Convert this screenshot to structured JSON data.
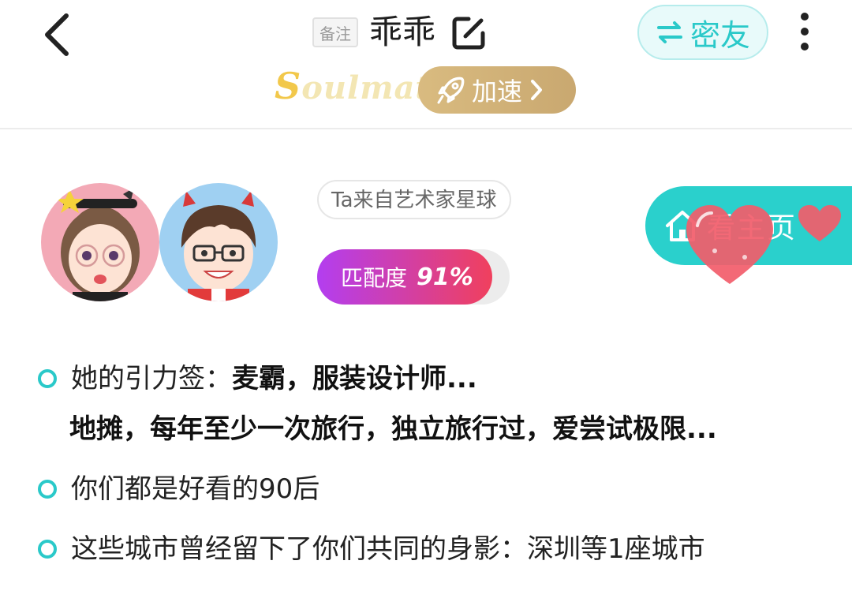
{
  "header": {
    "remark_label": "备注",
    "name": "乖乖",
    "miyou_label": "密友",
    "soulmate_cap": "S",
    "soulmate_rest": "oulmate",
    "speed_label": "加速"
  },
  "profile": {
    "planet": "Ta来自艺术家星球",
    "match_label": "匹配度",
    "match_value": "91%",
    "match_fraction": 0.91,
    "homepage_label": "看主页"
  },
  "info": {
    "tags_label": "她的引力签：",
    "tags_line1": "麦霸，服装设计师...",
    "tags_line2": "地摊，每年至少一次旅行，独立旅行过，爱尝试极限...",
    "age_text": "你们都是好看的90后",
    "city_text": "这些城市曾经留下了你们共同的身影：深圳等1座城市"
  },
  "colors": {
    "accent": "#2ac9c9",
    "gold": "#d4b478",
    "match_start": "#b33ef0",
    "match_end": "#f0405d",
    "heart": "#f25c6a"
  },
  "icons": [
    "back-icon",
    "edit-icon",
    "swap-icon",
    "more-icon",
    "rocket-icon",
    "chevron-right-icon",
    "home-icon",
    "heart-icon"
  ]
}
